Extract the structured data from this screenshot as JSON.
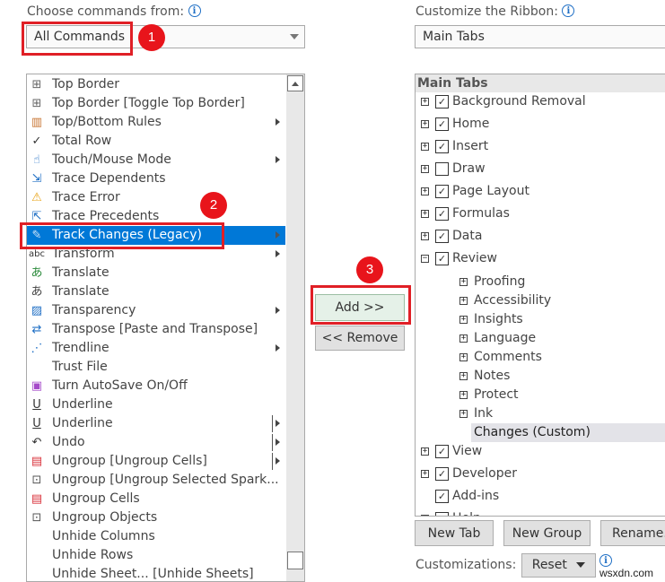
{
  "left": {
    "label": "Choose commands from:",
    "label_accel": "C",
    "dropdown_value": "All Commands",
    "commands": [
      {
        "label": "Top Border",
        "icon": "top-border-icon",
        "glyph": "⊞",
        "color": "#666",
        "submenu": false
      },
      {
        "label": "Top Border [Toggle Top Border]",
        "icon": "top-border-icon",
        "glyph": "⊞",
        "color": "#666",
        "submenu": false
      },
      {
        "label": "Top/Bottom Rules",
        "icon": "top-bottom-rules-icon",
        "glyph": "▥",
        "color": "#c87533",
        "submenu": true
      },
      {
        "label": "Total Row",
        "icon": "checkmark-icon",
        "glyph": "✓",
        "color": "#333",
        "submenu": false
      },
      {
        "label": "Touch/Mouse Mode",
        "icon": "touch-mode-icon",
        "glyph": "☝",
        "color": "#1f6fc5",
        "submenu": true
      },
      {
        "label": "Trace Dependents",
        "icon": "trace-dependents-icon",
        "glyph": "⇲",
        "color": "#1f6fc5",
        "submenu": false
      },
      {
        "label": "Trace Error",
        "icon": "warning-icon",
        "glyph": "⚠",
        "color": "#e8a317",
        "submenu": false
      },
      {
        "label": "Trace Precedents",
        "icon": "trace-precedents-icon",
        "glyph": "⇱",
        "color": "#1f6fc5",
        "submenu": false
      },
      {
        "label": "Track Changes (Legacy)",
        "icon": "track-changes-icon",
        "glyph": "✎",
        "color": "#cfe3f7",
        "submenu": true,
        "selected": true
      },
      {
        "label": "Transform",
        "icon": "transform-icon",
        "glyph": "abc",
        "color": "#333",
        "submenu": true
      },
      {
        "label": "Translate",
        "icon": "translate-icon",
        "glyph": "あ",
        "color": "#2a8a3a",
        "submenu": false
      },
      {
        "label": "Translate",
        "icon": "translate-document-icon",
        "glyph": "あ",
        "color": "#444",
        "submenu": false
      },
      {
        "label": "Transparency",
        "icon": "transparency-icon",
        "glyph": "▨",
        "color": "#1f6fc5",
        "submenu": true
      },
      {
        "label": "Transpose [Paste and Transpose]",
        "icon": "transpose-icon",
        "glyph": "⇄",
        "color": "#1f6fc5",
        "submenu": false
      },
      {
        "label": "Trendline",
        "icon": "trendline-icon",
        "glyph": "⋰",
        "color": "#1f6fc5",
        "submenu": true
      },
      {
        "label": "Trust File",
        "icon": "",
        "glyph": "",
        "color": "#444",
        "submenu": false
      },
      {
        "label": "Turn AutoSave On/Off",
        "icon": "autosave-icon",
        "glyph": "▣",
        "color": "#a64ac9",
        "submenu": false
      },
      {
        "label": "Underline",
        "icon": "underline-icon",
        "glyph": "U",
        "color": "#333",
        "submenu": false
      },
      {
        "label": "Underline",
        "icon": "underline-icon",
        "glyph": "U",
        "color": "#333",
        "submenu": true,
        "separator": true
      },
      {
        "label": "Undo",
        "icon": "undo-icon",
        "glyph": "↶",
        "color": "#333",
        "submenu": true,
        "separator": true
      },
      {
        "label": "Ungroup [Ungroup Cells]",
        "icon": "ungroup-cells-icon",
        "glyph": "▤",
        "color": "#d9303a",
        "submenu": true,
        "separator": true
      },
      {
        "label": "Ungroup [Ungroup Selected Spark...",
        "icon": "ungroup-icon",
        "glyph": "⊡",
        "color": "#555",
        "submenu": false
      },
      {
        "label": "Ungroup Cells",
        "icon": "ungroup-cells-icon",
        "glyph": "▤",
        "color": "#d9303a",
        "submenu": false
      },
      {
        "label": "Ungroup Objects",
        "icon": "ungroup-objects-icon",
        "glyph": "⊡",
        "color": "#555",
        "submenu": false
      },
      {
        "label": "Unhide Columns",
        "icon": "",
        "glyph": "",
        "color": "#444",
        "submenu": false
      },
      {
        "label": "Unhide Rows",
        "icon": "",
        "glyph": "",
        "color": "#444",
        "submenu": false
      },
      {
        "label": "Unhide Sheet... [Unhide Sheets]",
        "icon": "",
        "glyph": "",
        "color": "#444",
        "submenu": false
      }
    ]
  },
  "middle": {
    "add_label": "Add >>",
    "remove_label": "<< Remove"
  },
  "right": {
    "label": "Customize the Ribbon:",
    "dropdown_value": "Main Tabs",
    "tree_header": "Main Tabs",
    "tabs": [
      {
        "label": "Background Removal",
        "checked": true,
        "expander": "plus",
        "level": 0
      },
      {
        "label": "Home",
        "checked": true,
        "expander": "plus",
        "level": 0
      },
      {
        "label": "Insert",
        "checked": true,
        "expander": "plus",
        "level": 0
      },
      {
        "label": "Draw",
        "checked": false,
        "expander": "plus",
        "level": 0
      },
      {
        "label": "Page Layout",
        "checked": true,
        "expander": "plus",
        "level": 0
      },
      {
        "label": "Formulas",
        "checked": true,
        "expander": "plus",
        "level": 0
      },
      {
        "label": "Data",
        "checked": true,
        "expander": "plus",
        "level": 0
      },
      {
        "label": "Review",
        "checked": true,
        "expander": "minus",
        "level": 0
      },
      {
        "label": "Proofing",
        "expander": "plus",
        "level": 1
      },
      {
        "label": "Accessibility",
        "expander": "plus",
        "level": 1
      },
      {
        "label": "Insights",
        "expander": "plus",
        "level": 1
      },
      {
        "label": "Language",
        "expander": "plus",
        "level": 1
      },
      {
        "label": "Comments",
        "expander": "plus",
        "level": 1
      },
      {
        "label": "Notes",
        "expander": "plus",
        "level": 1
      },
      {
        "label": "Protect",
        "expander": "plus",
        "level": 1
      },
      {
        "label": "Ink",
        "expander": "plus",
        "level": 1
      },
      {
        "label": "Changes (Custom)",
        "expander": "none",
        "level": 1,
        "selected": true
      },
      {
        "label": "View",
        "checked": true,
        "expander": "plus",
        "level": 0
      },
      {
        "label": "Developer",
        "checked": true,
        "expander": "plus",
        "level": 0
      },
      {
        "label": "Add-ins",
        "checked": true,
        "expander": "none",
        "level": 0
      },
      {
        "label": "Help",
        "checked": true,
        "expander": "plus",
        "level": 0
      }
    ],
    "new_tab_label": "New Tab",
    "new_group_label": "New Group",
    "rename_label": "Rename...",
    "customizations_label": "Customizations:",
    "reset_label": "Reset"
  },
  "annotations": {
    "step1": "1",
    "step2": "2",
    "step3": "3"
  },
  "watermark": "wsxdn.com"
}
